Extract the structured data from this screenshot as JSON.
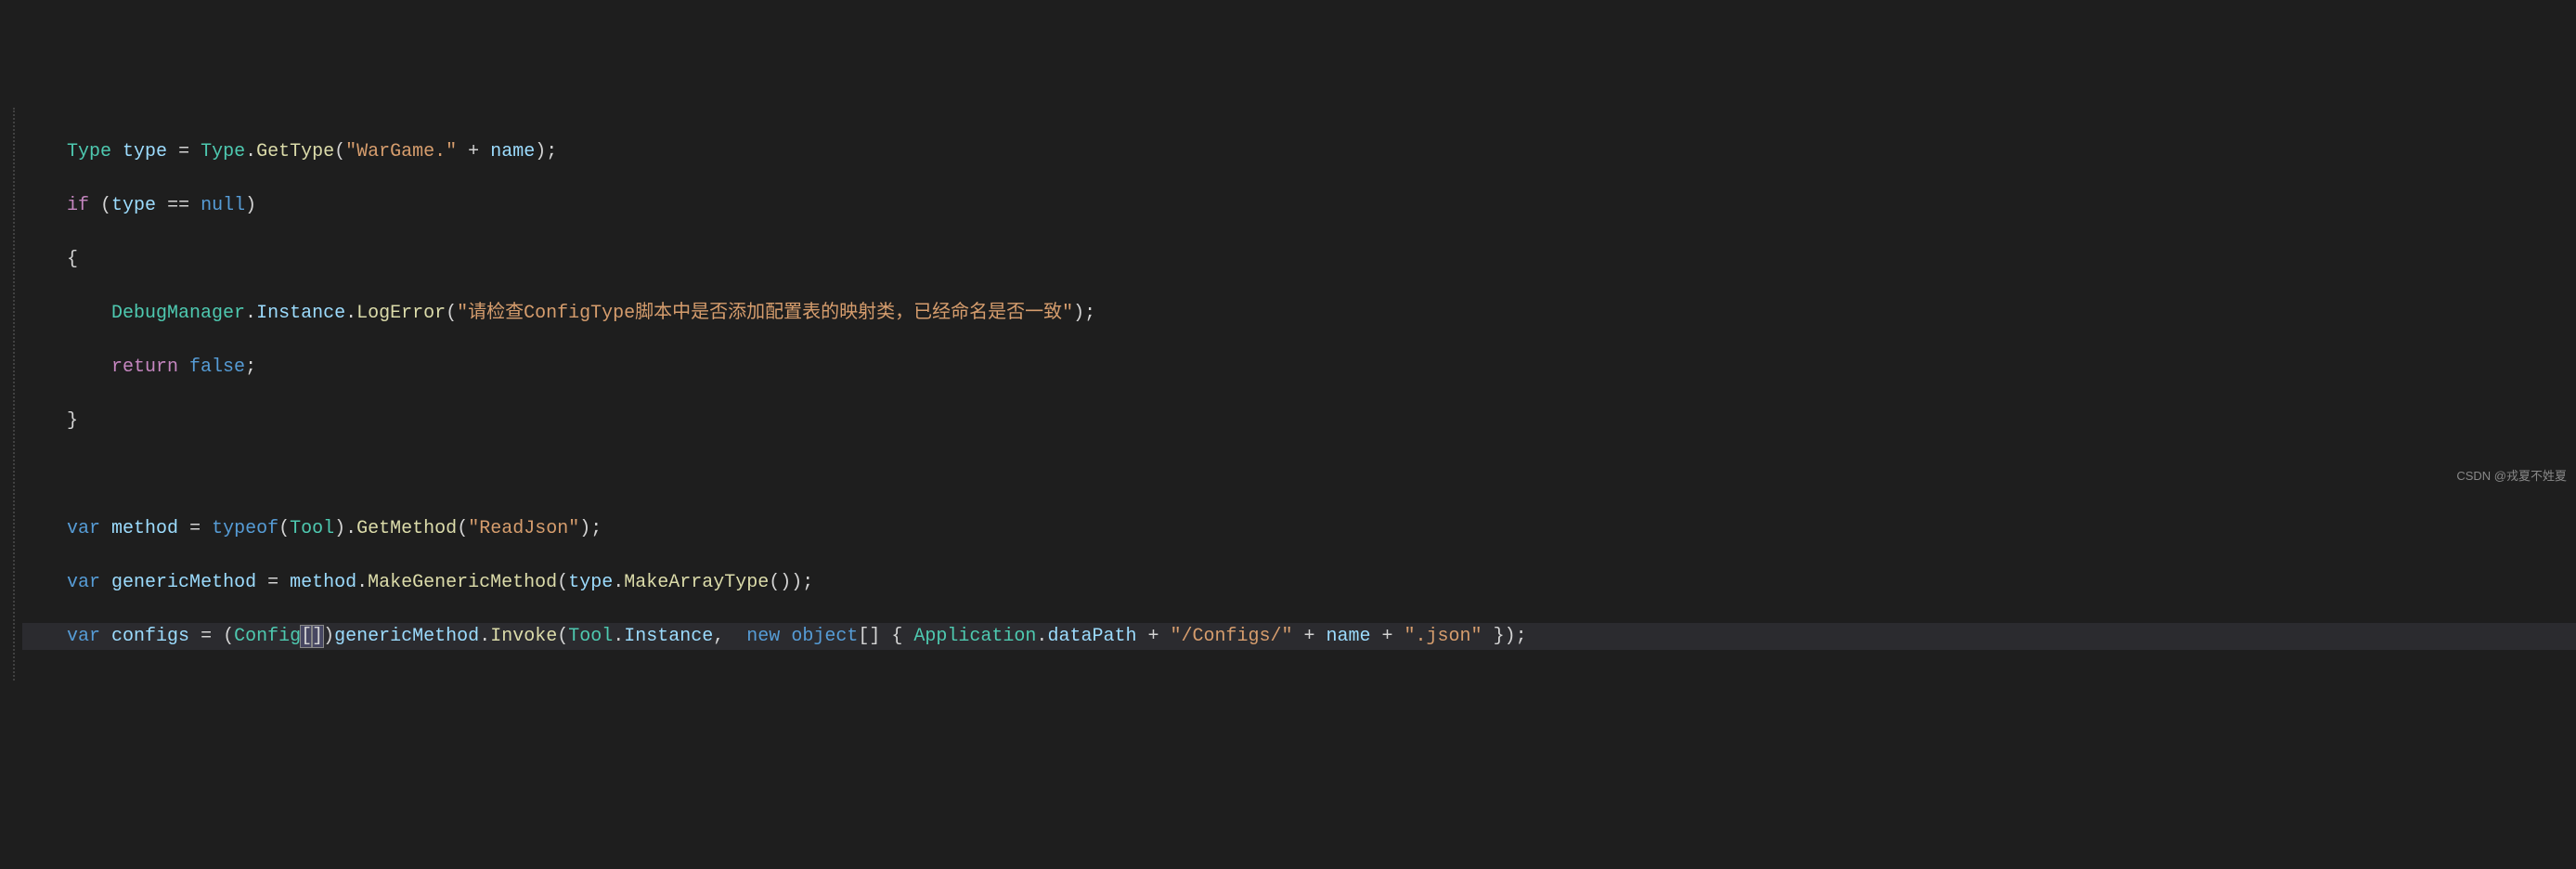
{
  "code": {
    "line1": {
      "type1": "Type",
      "var": "type",
      "op": " = ",
      "type2": "Type",
      "dot": ".",
      "method": "GetType",
      "paren_open": "(",
      "str1": "\"WarGame.\"",
      "plus": " + ",
      "var2": "name",
      "paren_close": ")",
      "semi": ";"
    },
    "line2": {
      "kw_if": "if",
      "paren_open": " (",
      "var": "type",
      "op": " == ",
      "kw_null": "null",
      "paren_close": ")"
    },
    "line3": {
      "brace": "{"
    },
    "line4": {
      "class": "DebugManager",
      "dot1": ".",
      "prop": "Instance",
      "dot2": ".",
      "method": "LogError",
      "paren_open": "(",
      "str": "\"请检查ConfigType脚本中是否添加配置表的映射类，已经命名是否一致\"",
      "paren_close": ")",
      "semi": ";"
    },
    "line5": {
      "kw_return": "return",
      "space": " ",
      "kw_false": "false",
      "semi": ";"
    },
    "line6": {
      "brace": "}"
    },
    "line8": {
      "kw_var": "var",
      "sp1": " ",
      "var": "method",
      "op": " = ",
      "kw_typeof": "typeof",
      "paren_open": "(",
      "type": "Tool",
      "paren_close": ")",
      "dot": ".",
      "method": "GetMethod",
      "paren_open2": "(",
      "str": "\"ReadJson\"",
      "paren_close2": ")",
      "semi": ";"
    },
    "line9": {
      "kw_var": "var",
      "sp1": " ",
      "var": "genericMethod",
      "op": " = ",
      "var2": "method",
      "dot": ".",
      "method": "MakeGenericMethod",
      "paren_open": "(",
      "var3": "type",
      "dot2": ".",
      "method2": "MakeArrayType",
      "parens": "()",
      "paren_close": ")",
      "semi": ";"
    },
    "line10": {
      "kw_var": "var",
      "sp1": " ",
      "var": "configs",
      "op": " = ",
      "paren_open": "(",
      "type": "Config",
      "bracket_open": "[",
      "bracket_close": "]",
      "paren_close": ")",
      "var2": "genericMethod",
      "dot": ".",
      "method": "Invoke",
      "paren_open2": "(",
      "type2": "Tool",
      "dot2": ".",
      "prop": "Instance",
      "comma": ", ",
      "kw_new": " new",
      "sp2": " ",
      "kw_object": "object",
      "brackets": "[]",
      "sp3": " ",
      "brace_open": "{ ",
      "class2": "Application",
      "dot3": ".",
      "prop2": "dataPath",
      "plus1": " + ",
      "str1": "\"/Configs/\"",
      "plus2": " + ",
      "var3": "name",
      "plus3": " + ",
      "str2": "\".json\"",
      "brace_close": " }",
      "paren_close2": ")",
      "semi": ";"
    }
  },
  "watermark": "CSDN @戎夏不姓夏"
}
